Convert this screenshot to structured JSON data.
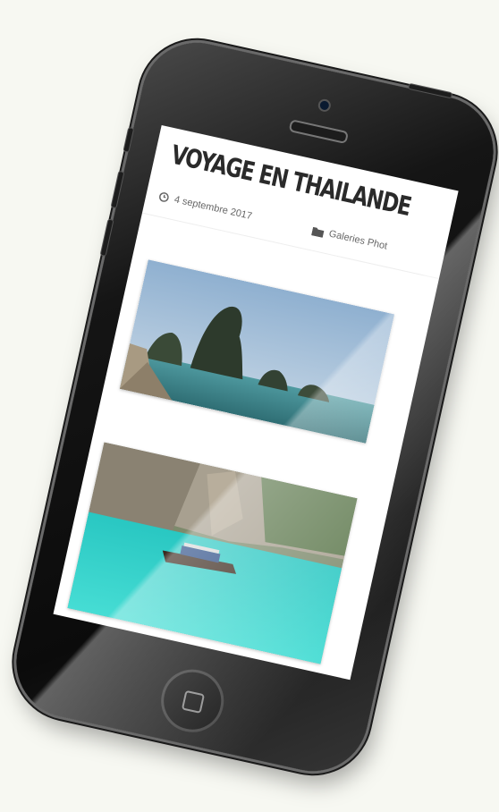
{
  "post": {
    "title": "VOYAGE EN THAILANDE",
    "date": "4 septembre 2017",
    "category": "Galeries Phot"
  },
  "icons": {
    "date": "clock-icon",
    "category": "folder-icon"
  },
  "colors": {
    "background": "#f7f8f2",
    "phone_body": "#111111",
    "screen": "#ffffff",
    "title_text": "#2a2a2a",
    "lagoon": "#2fd3c9",
    "sea": "#3f8a8e"
  }
}
